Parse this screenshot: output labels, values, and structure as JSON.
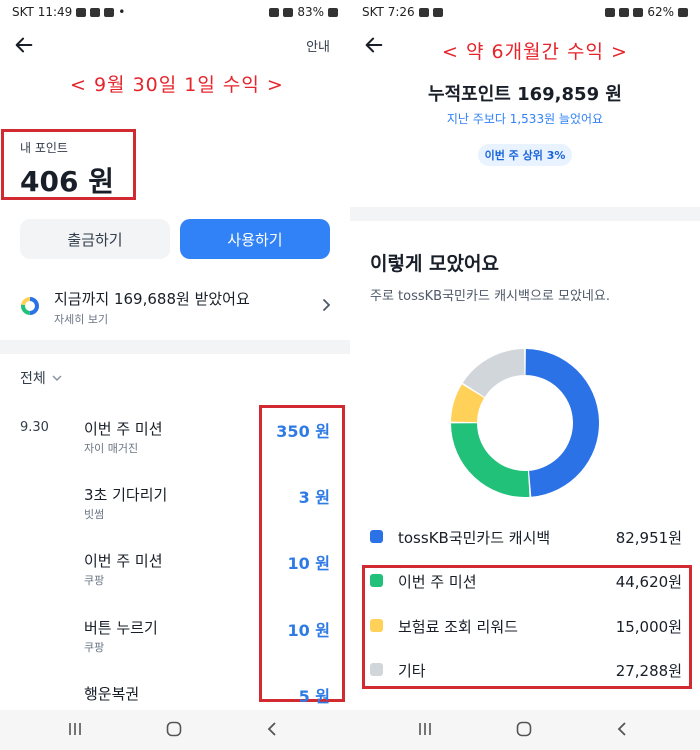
{
  "left": {
    "status": {
      "carrier_time": "SKT 11:49",
      "battery": "83%",
      "misc": "•"
    },
    "header": {
      "info_label": "안내"
    },
    "annotation": "< 9월 30일 1일 수익 >",
    "points": {
      "label": "내 포인트",
      "value": "406 원"
    },
    "buttons": {
      "withdraw": "출금하기",
      "use": "사용하기"
    },
    "summary": {
      "text": "지금까지 169,688원 받았어요",
      "link": "자세히 보기"
    },
    "filter": {
      "label": "전체"
    },
    "transactions": [
      {
        "date": "9.30",
        "title": "이번 주 미션",
        "source": "자이 매거진",
        "amount": "350 원"
      },
      {
        "date": "",
        "title": "3초 기다리기",
        "source": "빗썸",
        "amount": "3 원"
      },
      {
        "date": "",
        "title": "이번 주 미션",
        "source": "쿠팡",
        "amount": "10 원"
      },
      {
        "date": "",
        "title": "버튼 누르기",
        "source": "쿠팡",
        "amount": "10 원"
      },
      {
        "date": "",
        "title": "행운복권",
        "source": "",
        "amount": "5 원"
      }
    ]
  },
  "right": {
    "status": {
      "carrier_time": "SKT 7:26",
      "battery": "62%"
    },
    "annotation": "< 약 6개월간 수익 >",
    "cumulative": {
      "title": "누적포인트 169,859 원",
      "delta": "지난 주보다 1,533원 늘었어요",
      "badge": "이번 주 상위 3%"
    },
    "section": {
      "heading": "이렇게 모았어요",
      "description": "주로 tossKB국민카드 캐시백으로 모았네요."
    },
    "chart_data": {
      "type": "pie",
      "categories": [
        "tossKB국민카드 캐시백",
        "이번 주 미션",
        "보험료 조회 리워드",
        "기타"
      ],
      "values": [
        82951,
        44620,
        15000,
        27288
      ],
      "value_labels": [
        "82,951원",
        "44,620원",
        "15,000원",
        "27,288원"
      ],
      "colors": [
        "#2b72e6",
        "#22c17a",
        "#ffd159",
        "#d1d6db"
      ]
    }
  },
  "colors": {
    "accent": "#3182f6",
    "annotation_red": "#e5242b",
    "box_red": "#d12a31",
    "amount_blue": "#2f7be5"
  }
}
